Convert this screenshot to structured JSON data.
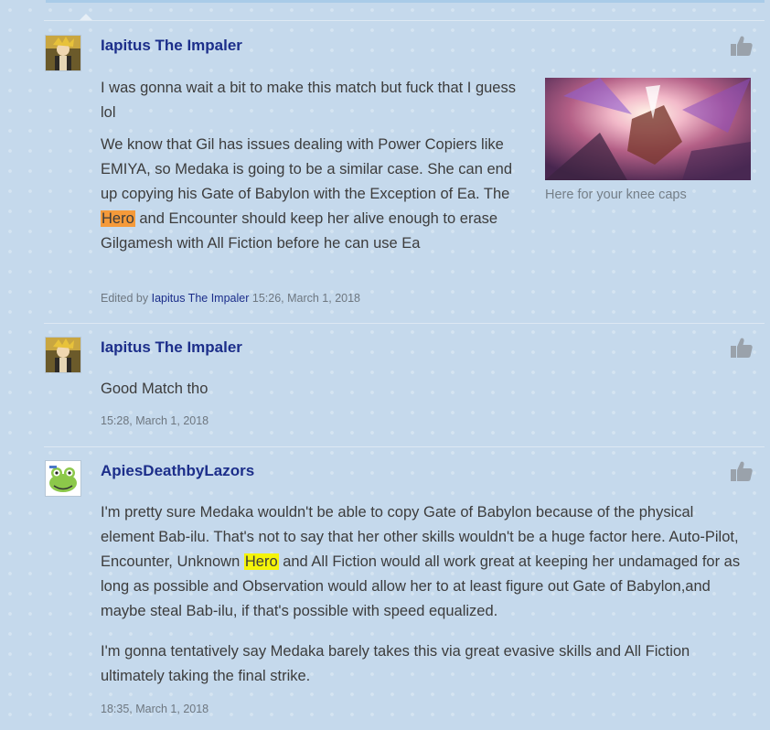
{
  "posts": [
    {
      "username": "Iapitus The Impaler",
      "paragraphs": [
        {
          "text": "I was gonna wait a bit to make this match but fuck that I guess lol"
        },
        {
          "before": "We know that Gil has issues dealing with Power Copiers like EMIYA, so Medaka is going to be a similar case. She can end up copying his Gate of Babylon with the Exception of Ea. The ",
          "highlight": "Hero",
          "after": " and Encounter should keep her alive enough to erase Gilgamesh with All Fiction before he can use Ea"
        }
      ],
      "image_caption": "Here for your knee caps",
      "edited_prefix": "Edited by",
      "edited_by": "Iapitus The Impaler",
      "timestamp": "15:26, March 1, 2018"
    },
    {
      "username": "Iapitus The Impaler",
      "paragraphs": [
        {
          "text": "Good Match tho"
        }
      ],
      "timestamp": "15:28, March 1, 2018"
    },
    {
      "username": "ApiesDeathbyLazors",
      "paragraphs": [
        {
          "before": "I'm pretty sure Medaka wouldn't be able to copy Gate of Babylon because of the physical element Bab-ilu. That's not to say that her other skills wouldn't be a huge factor here. Auto-Pilot, Encounter, Unknown ",
          "highlight": "Hero",
          "after": " and All Fiction would all work great at keeping her undamaged for as long as possible and Observation would allow her to at least figure out Gate of Babylon,and maybe steal Bab-ilu, if that's possible with speed equalized."
        },
        {
          "text": "I'm gonna tentatively say Medaka barely takes this via great evasive skills and All Fiction ultimately taking the final strike."
        }
      ],
      "timestamp": "18:35, March 1, 2018"
    }
  ],
  "icons": {
    "like": "thumbs-up-icon",
    "avatar_1": "anime-character-avatar",
    "avatar_2": "cartoon-frog-avatar"
  },
  "colors": {
    "background": "#c5d9ec",
    "username": "#1c2e8a",
    "highlight_orange": "#f59a3a",
    "highlight_yellow": "#f4f40a"
  }
}
